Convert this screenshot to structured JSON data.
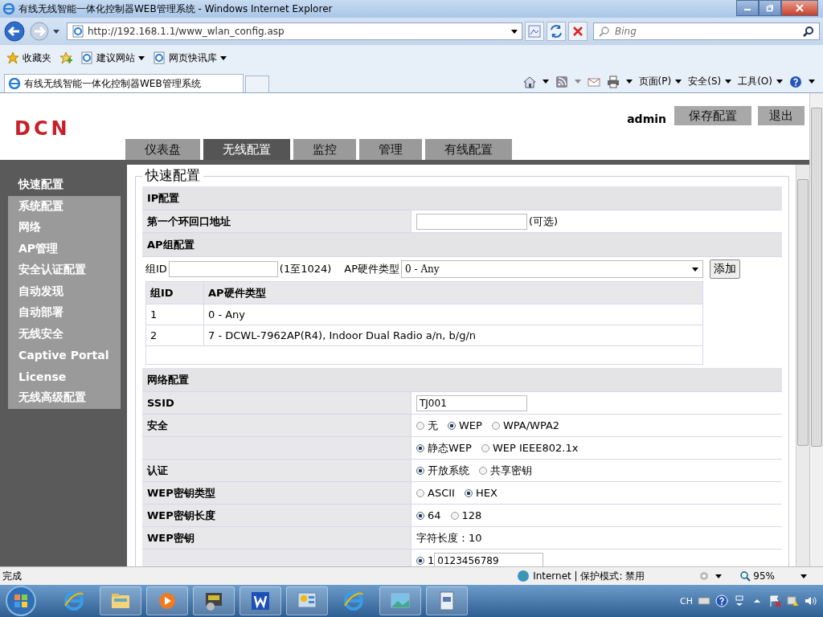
{
  "window": {
    "title": "有线无线智能一体化控制器WEB管理系统 - Windows Internet Explorer"
  },
  "address_bar": {
    "url": "http://192.168.1.1/www_wlan_config.asp",
    "search_placeholder": "Bing"
  },
  "favorites_bar": {
    "label": "收藏夹",
    "links": [
      "建议网站",
      "网页快讯库"
    ]
  },
  "browser_tabs": [
    {
      "label": "有线无线智能一体化控制器WEB管理系统",
      "selected": true
    }
  ],
  "command_bar": [
    "页面(P)",
    "安全(S)",
    "工具(O)"
  ],
  "header": {
    "logo": "DCN",
    "user": "admin",
    "buttons": [
      "保存配置",
      "退出"
    ]
  },
  "nav_tabs": [
    {
      "label": "仪表盘",
      "selected": false
    },
    {
      "label": "无线配置",
      "selected": true
    },
    {
      "label": "监控",
      "selected": false
    },
    {
      "label": "管理",
      "selected": false
    },
    {
      "label": "有线配置",
      "selected": false
    }
  ],
  "sidebar": [
    {
      "label": "快速配置",
      "selected": true
    },
    {
      "label": "系统配置",
      "selected": false
    },
    {
      "label": "网络",
      "selected": false
    },
    {
      "label": "AP管理",
      "selected": false
    },
    {
      "label": "安全认证配置",
      "selected": false
    },
    {
      "label": "自动发现",
      "selected": false
    },
    {
      "label": "自动部署",
      "selected": false
    },
    {
      "label": "无线安全",
      "selected": false
    },
    {
      "label": "Captive Portal",
      "selected": false
    },
    {
      "label": "License",
      "selected": false
    },
    {
      "label": "无线高级配置",
      "selected": false
    }
  ],
  "panel_title": "快速配置",
  "ip_section": {
    "title": "IP配置",
    "label": "第一个环回口地址",
    "hint": "(可选)"
  },
  "ap_group_section": {
    "title": "AP组配置",
    "id_label": "组ID",
    "range": "(1至1024)",
    "type_label": "AP硬件类型",
    "type_value": "0 - Any",
    "add_button": "添加",
    "columns": [
      "组ID",
      "AP硬件类型"
    ],
    "rows": [
      [
        "1",
        "0 - Any"
      ],
      [
        "2",
        "7 - DCWL-7962AP(R4), Indoor Dual Radio a/n, b/g/n"
      ]
    ]
  },
  "network_section": {
    "title": "网络配置",
    "rows": [
      {
        "kind": "input",
        "label": "SSID",
        "value": "TJ001"
      },
      {
        "kind": "radio",
        "label": "安全",
        "options": [
          {
            "label": "无",
            "selected": false
          },
          {
            "label": "WEP",
            "selected": true
          },
          {
            "label": "WPA/WPA2",
            "selected": false
          }
        ]
      },
      {
        "kind": "radio",
        "options": [
          {
            "label": "静态WEP",
            "selected": true
          },
          {
            "label": "WEP IEEE802.1x",
            "selected": false
          }
        ]
      },
      {
        "kind": "radio",
        "label": "认证",
        "options": [
          {
            "label": "开放系统",
            "selected": true
          },
          {
            "label": "共享密钥",
            "selected": false
          }
        ]
      },
      {
        "kind": "radio",
        "label": "WEP密钥类型",
        "options": [
          {
            "label": "ASCII",
            "selected": false
          },
          {
            "label": "HEX",
            "selected": true
          }
        ]
      },
      {
        "kind": "radio",
        "label": "WEP密钥长度",
        "options": [
          {
            "label": "64",
            "selected": true
          },
          {
            "label": "128",
            "selected": false
          }
        ]
      },
      {
        "kind": "text",
        "label": "WEP密钥",
        "value": "字符长度：10"
      },
      {
        "kind": "key",
        "selected": true,
        "index": "1",
        "value": "0123456789"
      }
    ]
  },
  "status_bar": {
    "text": "完成",
    "zone": "Internet | 保护模式: 禁用",
    "zoom": "95%"
  },
  "taskbar": {
    "language": "CH"
  }
}
